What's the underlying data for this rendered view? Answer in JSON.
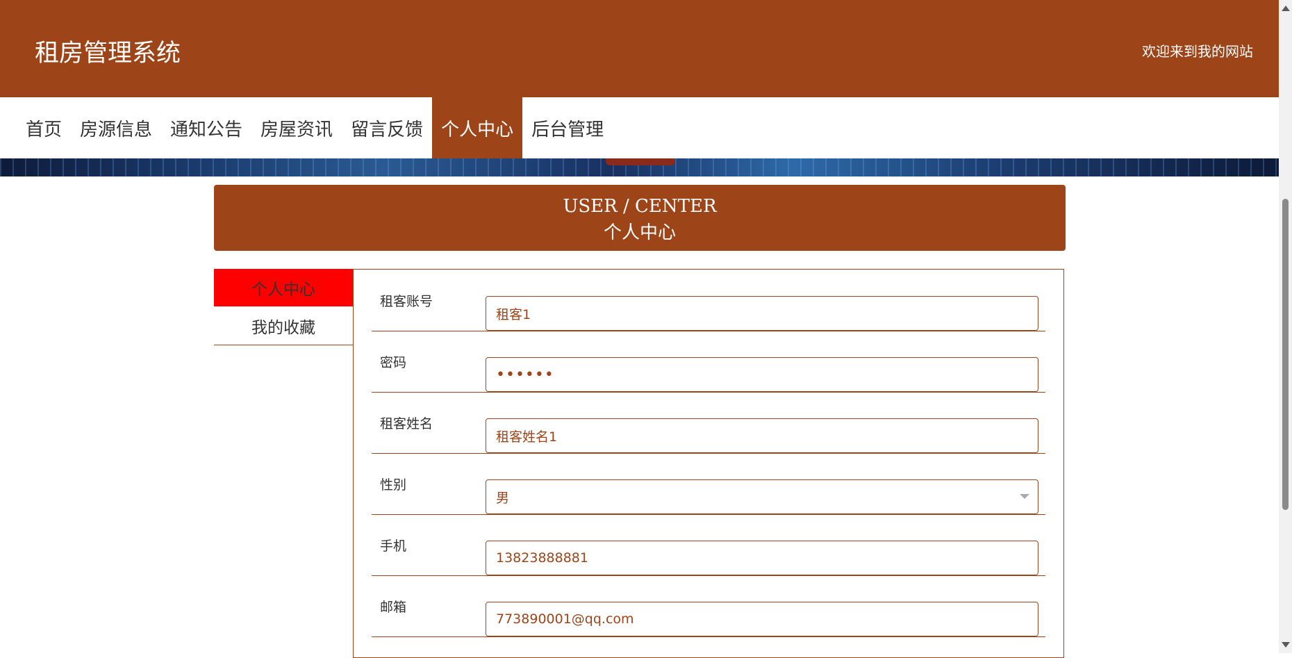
{
  "header": {
    "title": "租房管理系统",
    "welcome": "欢迎来到我的网站"
  },
  "nav": {
    "items": [
      {
        "label": "首页"
      },
      {
        "label": "房源信息"
      },
      {
        "label": "通知公告"
      },
      {
        "label": "房屋资讯"
      },
      {
        "label": "留言反馈"
      },
      {
        "label": "个人中心",
        "active": true
      },
      {
        "label": "后台管理"
      }
    ]
  },
  "center_head": {
    "en": "USER / CENTER",
    "cn": "个人中心"
  },
  "side": {
    "items": [
      {
        "label": "个人中心",
        "active": true
      },
      {
        "label": "我的收藏"
      }
    ]
  },
  "form": {
    "fields": [
      {
        "label": "租客账号",
        "value": "租客1"
      },
      {
        "label": "密码",
        "value": "••••••"
      },
      {
        "label": "租客姓名",
        "value": "租客姓名1"
      },
      {
        "label": "性别",
        "value": "男"
      },
      {
        "label": "手机",
        "value": "13823888881"
      },
      {
        "label": "邮箱",
        "value": "773890001@qq.com"
      }
    ]
  },
  "colors": {
    "brand": "#9e4419",
    "active_side": "#ff0000"
  }
}
